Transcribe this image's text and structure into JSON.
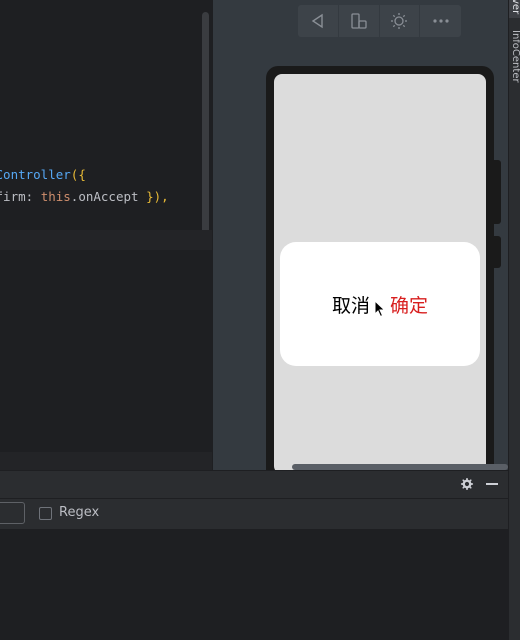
{
  "editor": {
    "line1": {
      "fn": "gController",
      "paren": "({"
    },
    "line2": {
      "text": "nfirm: ",
      "this": "this",
      "field": ".onAccept ",
      "close": "}),"
    }
  },
  "previewer": {
    "toolbar": {
      "buttons": [
        {
          "icon": "back-triangle-icon"
        },
        {
          "icon": "device-rotate-icon"
        },
        {
          "icon": "brightness-icon"
        },
        {
          "icon": "more-icon"
        }
      ]
    },
    "dialog": {
      "cancel_label": "取消",
      "confirm_label": "确定",
      "cancel_color": "#000000",
      "confirm_color": "#d81e1e"
    }
  },
  "right_strip": {
    "top_label": "ver",
    "label": "InfoCenter"
  },
  "find_panel": {
    "regex_label": "Regex",
    "regex_checked": false
  },
  "colors": {
    "editor_bg": "#1e1f22",
    "panel_bg": "#2b2d30",
    "previewer_bg": "#343a40",
    "screen_bg": "#dcdcdc"
  }
}
